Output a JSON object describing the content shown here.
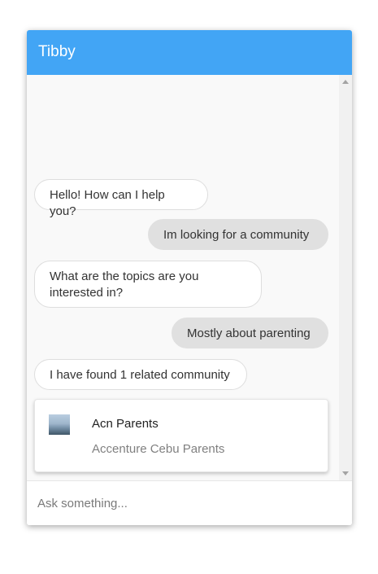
{
  "header": {
    "title": "Tibby",
    "color": "#42a5f5"
  },
  "messages": [
    {
      "from": "bot",
      "text": "Hello! How can I help you?"
    },
    {
      "from": "user",
      "text": "Im looking for a community"
    },
    {
      "from": "bot",
      "text": "What are the topics are you interested in?"
    },
    {
      "from": "user",
      "text": "Mostly about parenting"
    },
    {
      "from": "bot",
      "text": "I have found 1 related community"
    }
  ],
  "community_card": {
    "title": "Acn Parents",
    "subtitle": "Accenture Cebu Parents"
  },
  "input": {
    "placeholder": "Ask something...",
    "value": ""
  }
}
